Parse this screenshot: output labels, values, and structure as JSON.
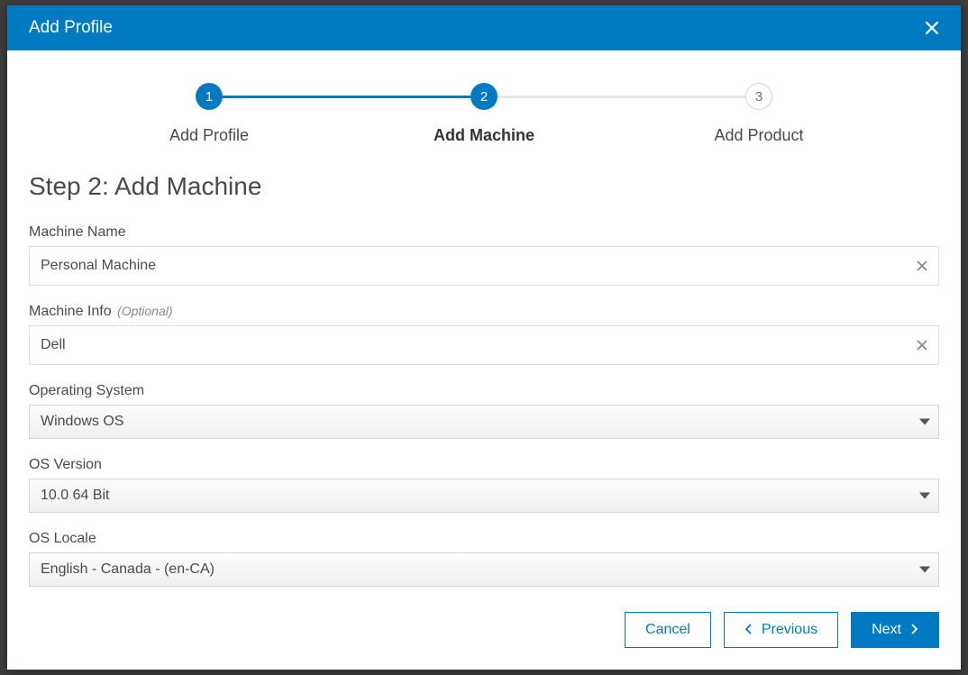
{
  "modal": {
    "title": "Add Profile"
  },
  "stepper": {
    "steps": [
      {
        "num": "1",
        "label": "Add Profile"
      },
      {
        "num": "2",
        "label": "Add Machine"
      },
      {
        "num": "3",
        "label": "Add Product"
      }
    ]
  },
  "section": {
    "title": "Step 2: Add Machine"
  },
  "fields": {
    "machine_name": {
      "label": "Machine Name",
      "value": "Personal Machine"
    },
    "machine_info": {
      "label": "Machine Info",
      "optional": "(Optional)",
      "value": "Dell"
    },
    "os": {
      "label": "Operating System",
      "value": "Windows OS"
    },
    "os_version": {
      "label": "OS Version",
      "value": "10.0 64 Bit"
    },
    "os_locale": {
      "label": "OS Locale",
      "value": "English - Canada - (en-CA)"
    }
  },
  "footer": {
    "cancel": "Cancel",
    "previous": "Previous",
    "next": "Next"
  }
}
